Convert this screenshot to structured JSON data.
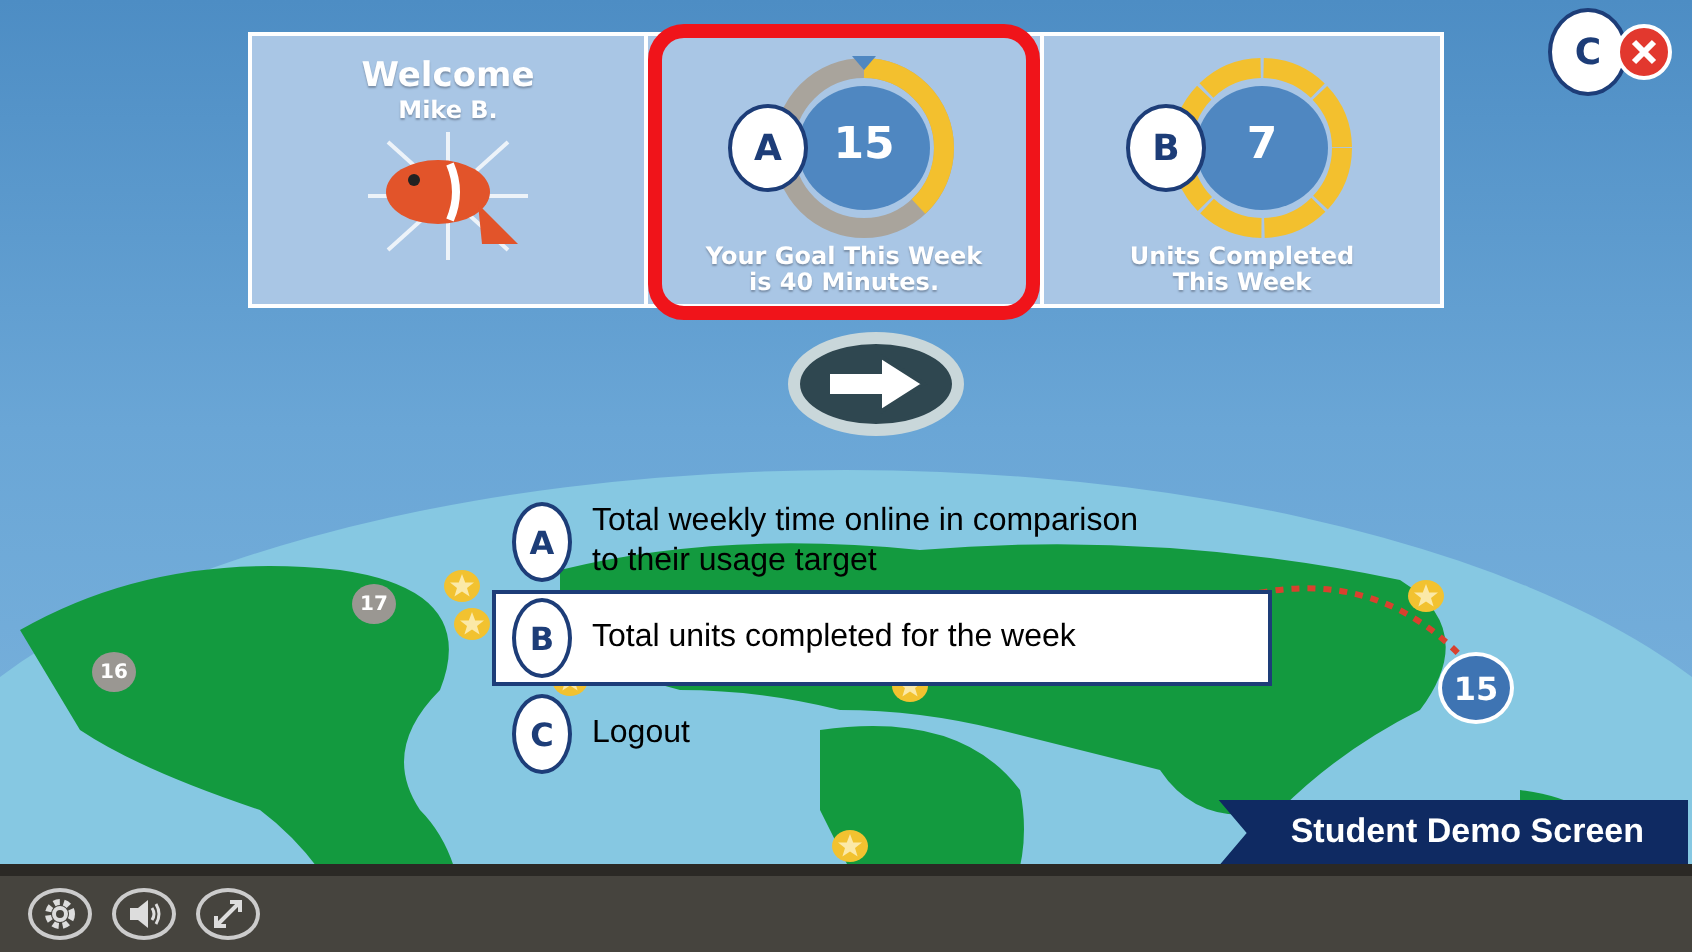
{
  "welcome": {
    "title": "Welcome",
    "name": "Mike B."
  },
  "goal": {
    "callout": "A",
    "value": "15",
    "caption": [
      "Your Goal This Week",
      "is 40 Minutes."
    ],
    "level": 0.38,
    "highlighted": true
  },
  "units": {
    "callout": "B",
    "value": "7",
    "caption": [
      "Units Completed",
      "This Week"
    ]
  },
  "close": {
    "callout": "C"
  },
  "legend": [
    {
      "letter": "A",
      "text": "Total weekly time online in comparison to their usage target",
      "highlighted": false
    },
    {
      "letter": "B",
      "text": "Total units completed for the week",
      "highlighted": true
    },
    {
      "letter": "C",
      "text": "Logout",
      "highlighted": false
    }
  ],
  "map_markers": [
    {
      "label": "17",
      "kind": "past"
    },
    {
      "label": "16",
      "kind": "past"
    },
    {
      "label": "15",
      "kind": "current"
    }
  ],
  "banner": "Student Demo Screen"
}
